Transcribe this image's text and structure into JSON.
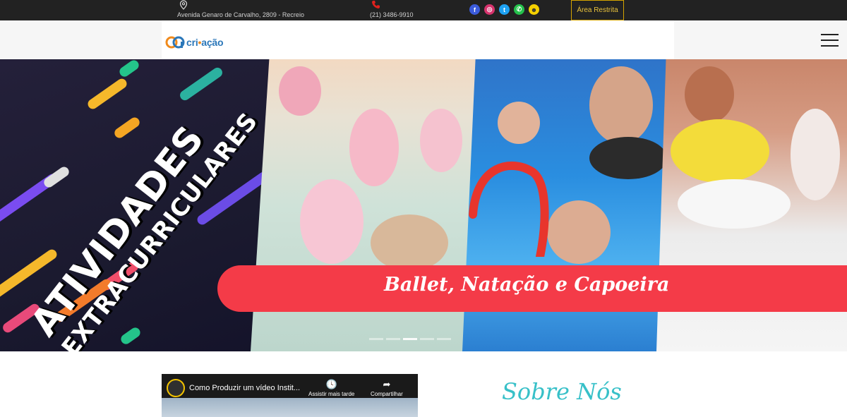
{
  "topbar": {
    "address": "Avenida Genaro de Carvalho, 2809 - Recreio",
    "phone": "(21) 3486-9910",
    "social_icons": [
      "facebook-icon",
      "instagram-icon",
      "twitter-icon",
      "whatsapp-icon",
      "snapchat-icon"
    ],
    "restricted_area": "Área Restrita"
  },
  "header": {
    "logo_text_a": "cri",
    "logo_text_b": "ação",
    "menu_icon": "hamburger-menu-icon"
  },
  "hero": {
    "headline_1": "ATIVIDADES",
    "headline_2": "EXTRACURRICULARES",
    "banner": "Ballet, Natação e Capoeira",
    "slide_count": 5,
    "active_slide": 2
  },
  "video": {
    "title": "Como Produzir um vídeo Instit...",
    "watch_later": "Assistir mais tarde",
    "share": "Compartilhar"
  },
  "about": {
    "title": "Sobre Nós"
  },
  "colors": {
    "topbar_bg": "#222222",
    "accent_gold": "#d4a300",
    "banner_red": "#f43b48",
    "about_teal": "#37c0c8"
  }
}
